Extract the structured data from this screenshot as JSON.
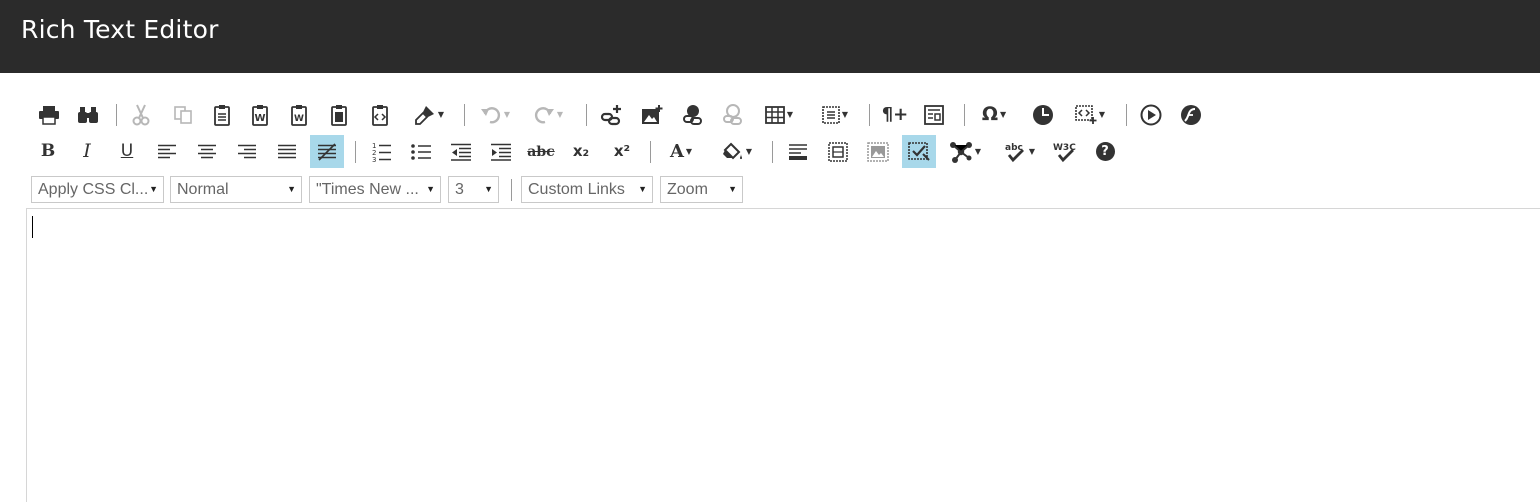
{
  "header": {
    "title": "Rich Text Editor"
  },
  "toolbar": {
    "row2": {
      "bold": "B",
      "italic": "I",
      "underline": "U",
      "strikethrough": "abc",
      "subscript": "x₂",
      "superscript": "x²",
      "font_color": "A",
      "help": "?"
    },
    "row3": {
      "css_class": "Apply CSS Cl...",
      "paragraph_style": "Normal",
      "font_name": "\"Times New ...",
      "font_size": "3",
      "custom_links": "Custom Links",
      "zoom": "Zoom"
    }
  },
  "colors": {
    "header_bg": "#2b2b2b",
    "active_tool_bg": "#a8d8ea",
    "icon": "#333333"
  }
}
